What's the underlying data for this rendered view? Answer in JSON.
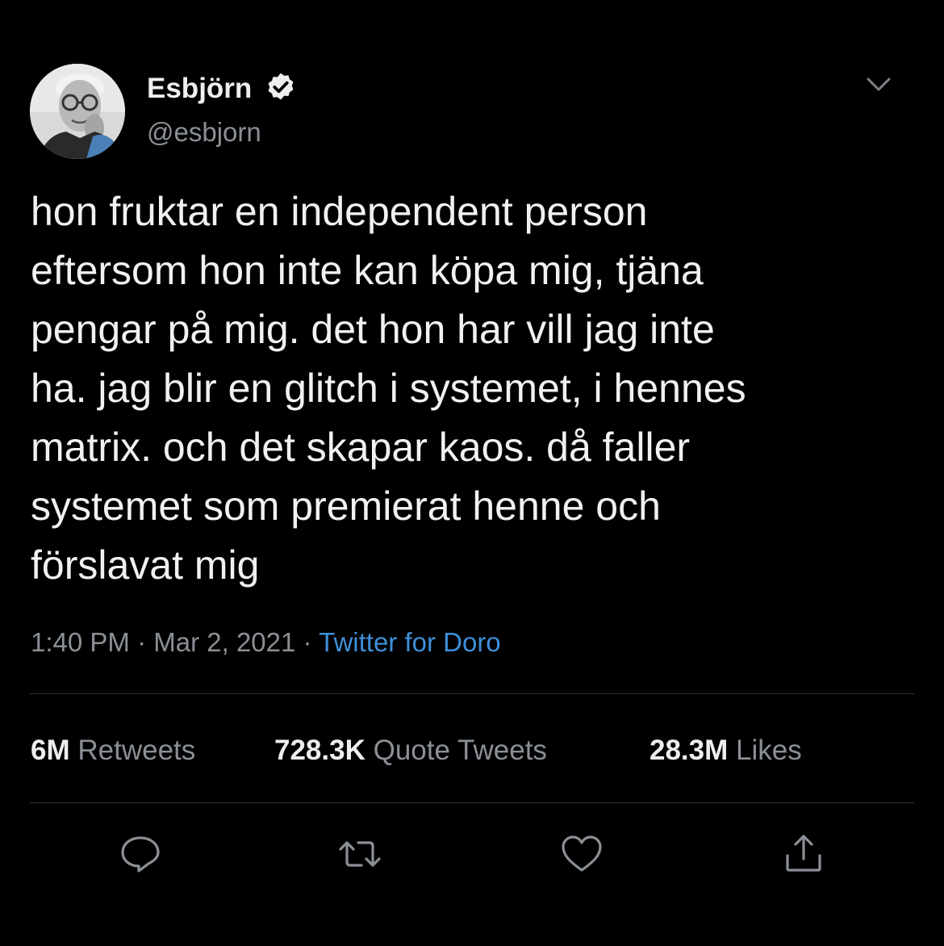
{
  "author": {
    "name": "Esbjörn",
    "handle": "@esbjorn",
    "verified": true,
    "avatar_icon": "profile-photo"
  },
  "tweet": {
    "lines": [
      "hon fruktar en independent person",
      "eftersom hon inte kan köpa mig, tjäna",
      "pengar på mig. det hon har vill jag inte",
      "ha. jag blir en glitch i systemet, i hennes",
      "matrix. och det skapar kaos. då faller",
      "systemet som premierat henne och",
      "förslavat mig"
    ],
    "time": "1:40 PM",
    "date": "Mar 2, 2021",
    "separator": "·",
    "source": "Twitter for Doro"
  },
  "stats": {
    "retweets": {
      "count": "6M",
      "label": "Retweets"
    },
    "quotes": {
      "count": "728.3K",
      "label": "Quote Tweets"
    },
    "likes": {
      "count": "28.3M",
      "label": "Likes"
    }
  },
  "actions": {
    "reply_icon": "reply-icon",
    "retweet_icon": "retweet-icon",
    "like_icon": "heart-icon",
    "share_icon": "share-icon"
  },
  "colors": {
    "background": "#000000",
    "text": "#f1f1f1",
    "secondary": "#8b9096",
    "link": "#3f8fd8",
    "divider": "#2f3336"
  }
}
